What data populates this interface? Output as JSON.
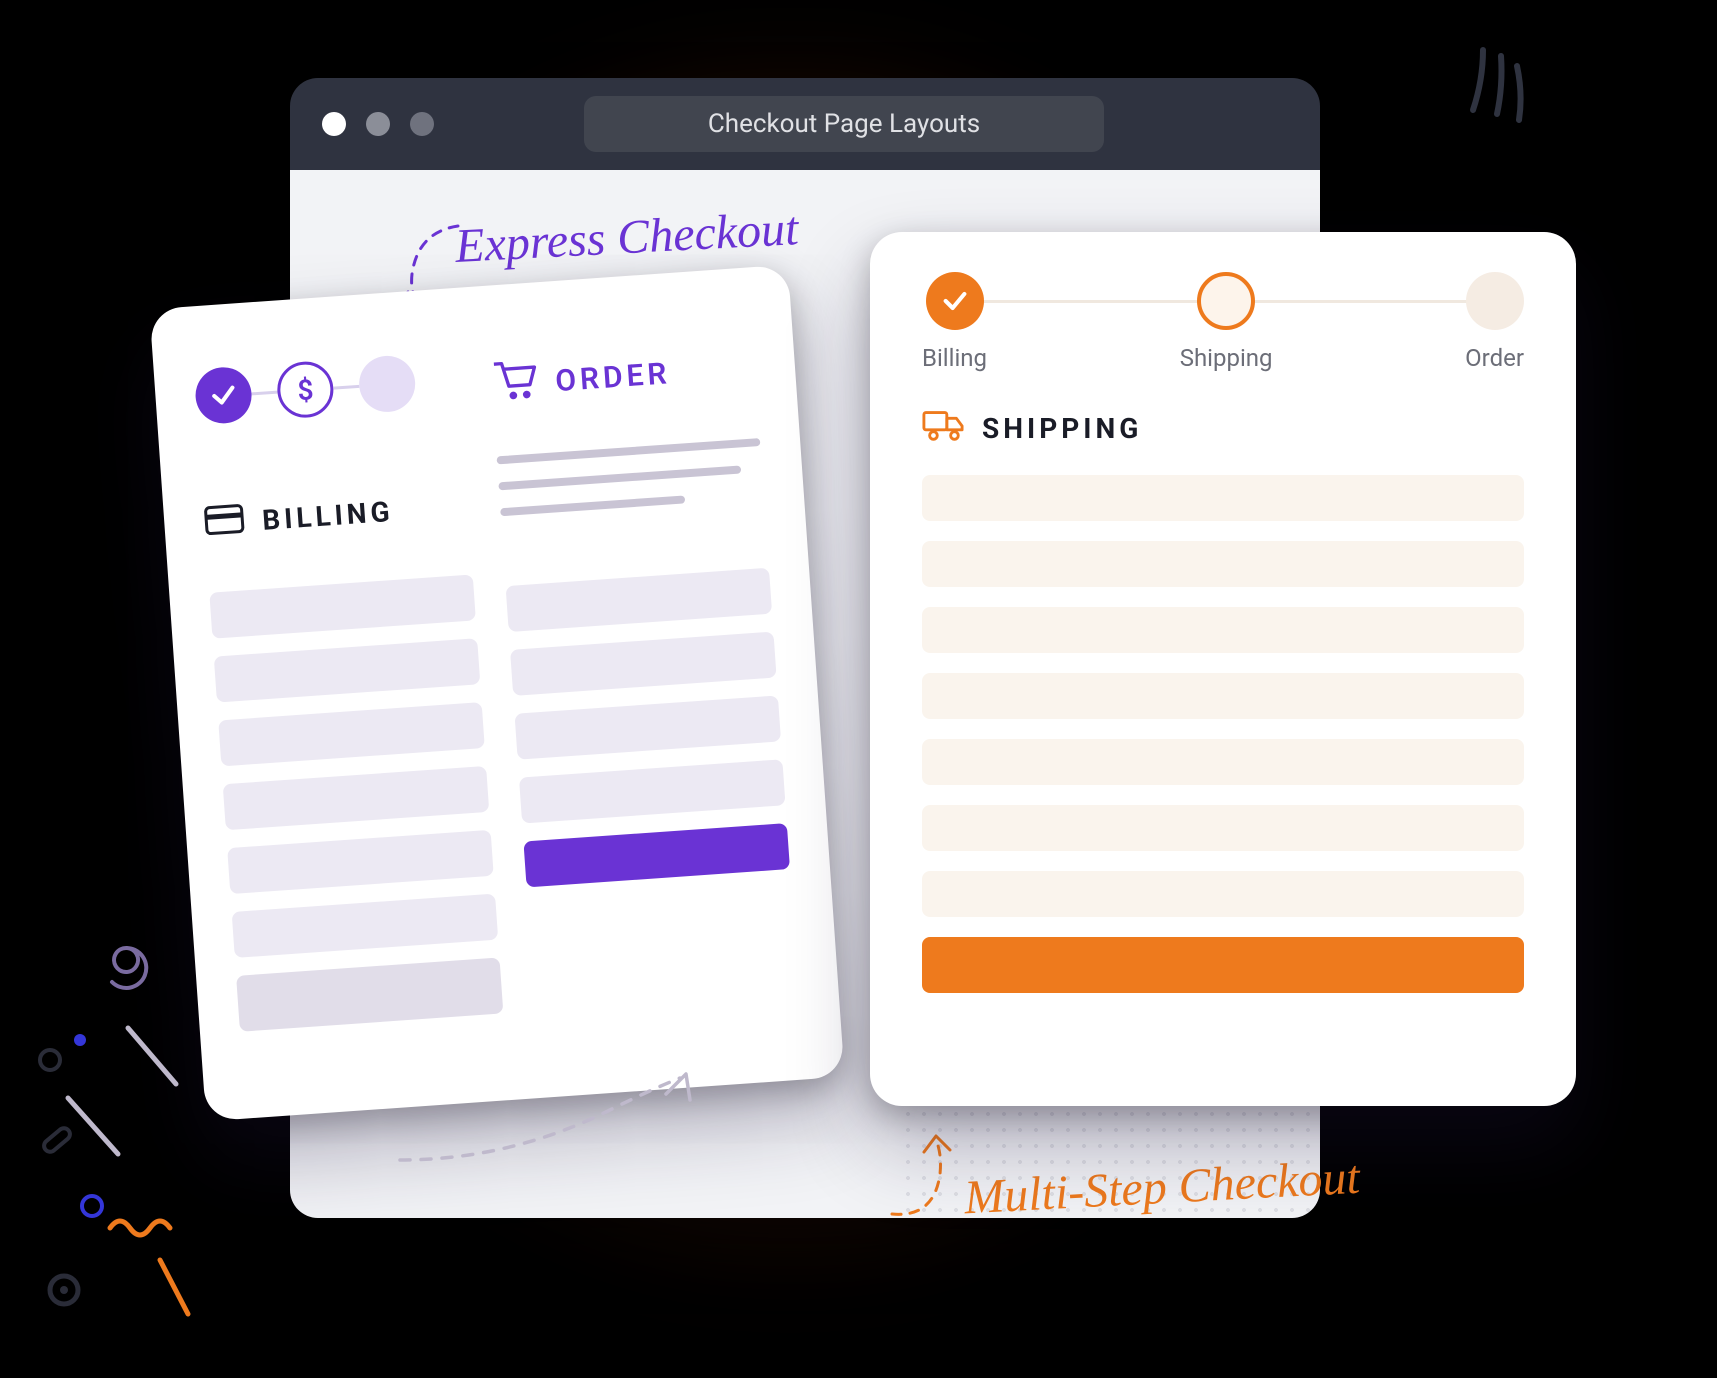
{
  "window": {
    "title": "Checkout Page Layouts"
  },
  "labels": {
    "express": "Express Checkout",
    "multi": "Multi-Step Checkout"
  },
  "express": {
    "order_heading": "ORDER",
    "billing_heading": "BILLING",
    "steps": {
      "done_icon": "check",
      "current_icon": "dollar"
    },
    "colors": {
      "accent": "#6a33d4"
    }
  },
  "multi": {
    "steps": [
      {
        "label": "Billing",
        "state": "done"
      },
      {
        "label": "Shipping",
        "state": "current"
      },
      {
        "label": "Order",
        "state": "next"
      }
    ],
    "section_heading": "SHIPPING",
    "colors": {
      "accent": "#ee7a1d"
    }
  }
}
